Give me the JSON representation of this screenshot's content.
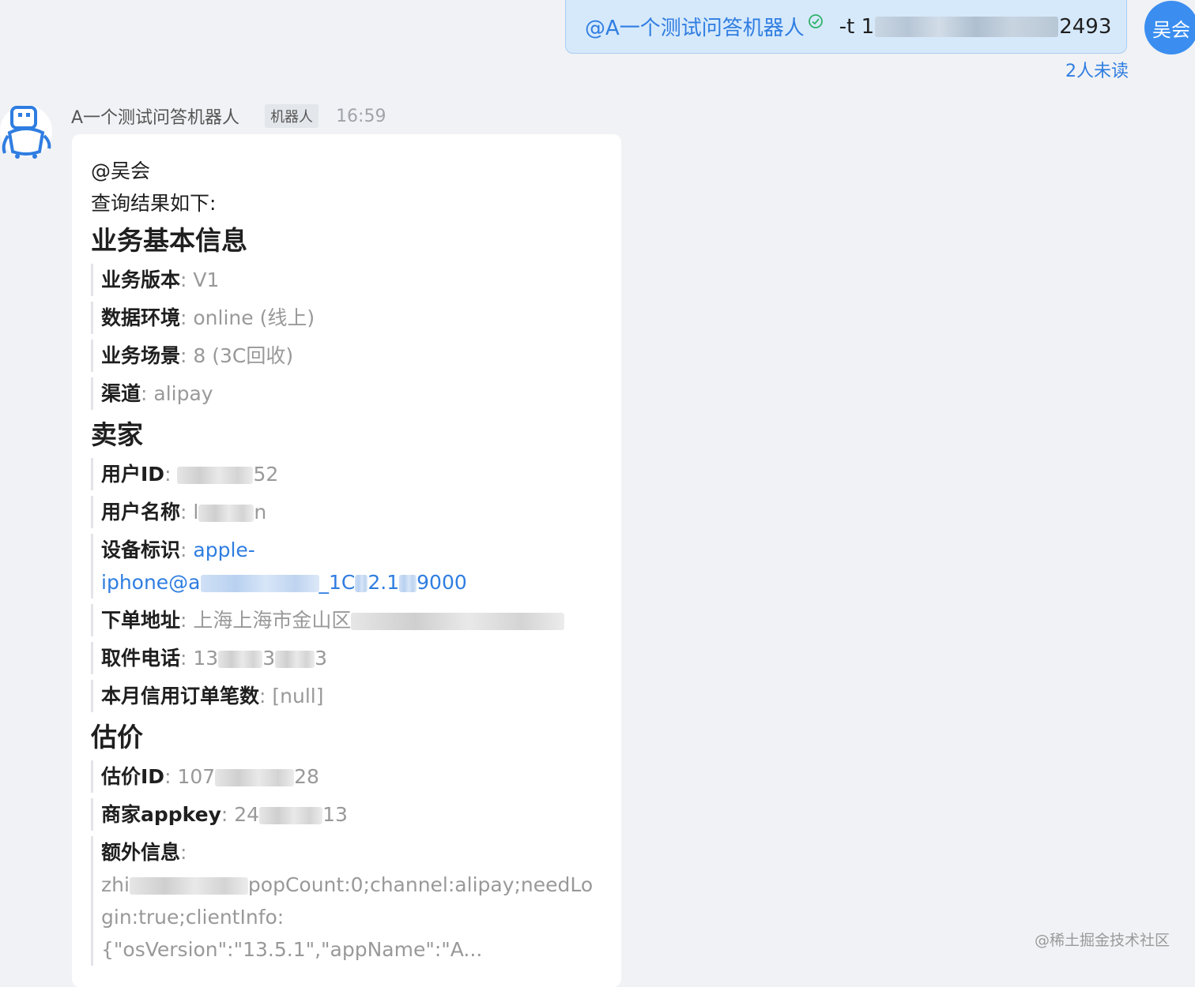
{
  "outgoing": {
    "mention": "@A一个测试问答机器人",
    "command_prefix": "-t 1",
    "command_suffix": "2493",
    "avatar_label": "吴会",
    "unread": "2人未读"
  },
  "incoming": {
    "sender": "A一个测试问答机器人",
    "badge": "机器人",
    "time": "16:59",
    "mention": "@吴会",
    "intro": "查询结果如下:",
    "sections": {
      "basic": {
        "title": "业务基本信息",
        "version_k": "业务版本",
        "version_v": "V1",
        "env_k": "数据环境",
        "env_v": "online (线上)",
        "scene_k": "业务场景",
        "scene_v": "8 (3C回收)",
        "channel_k": "渠道",
        "channel_v": "alipay"
      },
      "seller": {
        "title": "卖家",
        "uid_k": "用户ID",
        "uid_tail": "52",
        "uname_k": "用户名称",
        "uname_head": "l",
        "uname_tail": "n",
        "device_k": "设备标识",
        "device_head": "apple-",
        "device_line2_head": "iphone@a",
        "device_mid": "_1C",
        "device_mid2": "2.1",
        "device_tail": "9000",
        "addr_k": "下单地址",
        "addr_v": "上海上海市金山区",
        "phone_k": "取件电话",
        "phone_head": "13",
        "phone_mid": "3",
        "phone_tail": "3",
        "credit_k": "本月信用订单笔数",
        "credit_v": "[null]"
      },
      "estimate": {
        "title": "估价",
        "eid_k": "估价ID",
        "eid_head": "107",
        "eid_tail": "28",
        "appkey_k": "商家appkey",
        "appkey_head": "24",
        "appkey_tail": "13",
        "extra_k": "额外信息",
        "extra_head": "zhi",
        "extra_v1": "popCount:0;channel:alipay;needLo",
        "extra_v2": "gin:true;clientInfo:",
        "extra_v3": "{\"osVersion\":\"13.5.1\",\"appName\":\"A..."
      }
    }
  },
  "footer": "@稀土掘金技术社区",
  "colors": {
    "accent": "#2f7de1",
    "bubble": "#d6e9fb",
    "verified": "#2fb36b"
  }
}
